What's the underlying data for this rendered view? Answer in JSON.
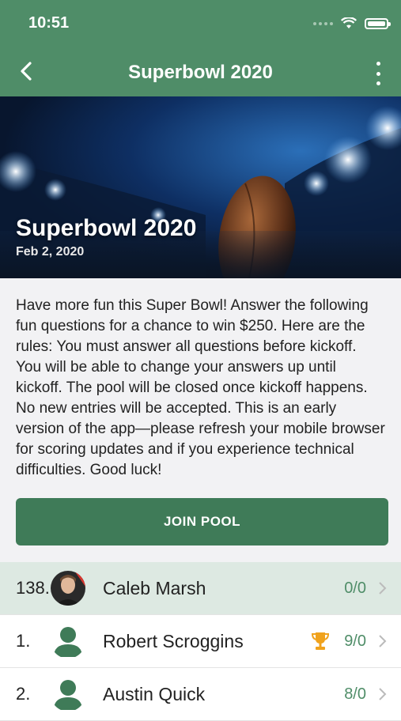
{
  "status_bar": {
    "time": "10:51"
  },
  "header": {
    "title": "Superbowl 2020"
  },
  "hero": {
    "title": "Superbowl 2020",
    "date": "Feb 2, 2020"
  },
  "description": "Have more fun this Super Bowl! Answer the following fun questions for a chance to win $250. Here are the rules: You must answer all questions before kickoff. You will be able to change your answers up until kickoff. The pool will be closed once kickoff happens. No new entries will be accepted. This is an early version of the app—please refresh your mobile browser for scoring updates and if you experience technical difficulties. Good luck!",
  "join_button": {
    "label": "JOIN POOL"
  },
  "leaderboard": [
    {
      "rank": "138.",
      "name": "Caleb Marsh",
      "score": "0/0",
      "is_current_user": true,
      "avatar": "photo"
    },
    {
      "rank": "1.",
      "name": "Robert Scroggins",
      "score": "9/0",
      "trophy": true,
      "avatar": "person-icon"
    },
    {
      "rank": "2.",
      "name": "Austin Quick",
      "score": "8/0",
      "avatar": "person-icon"
    }
  ],
  "colors": {
    "brand": "#4f8d68",
    "button": "#3f7b58",
    "trophy": "#f0a21c",
    "highlight_row": "#dde9e2"
  }
}
